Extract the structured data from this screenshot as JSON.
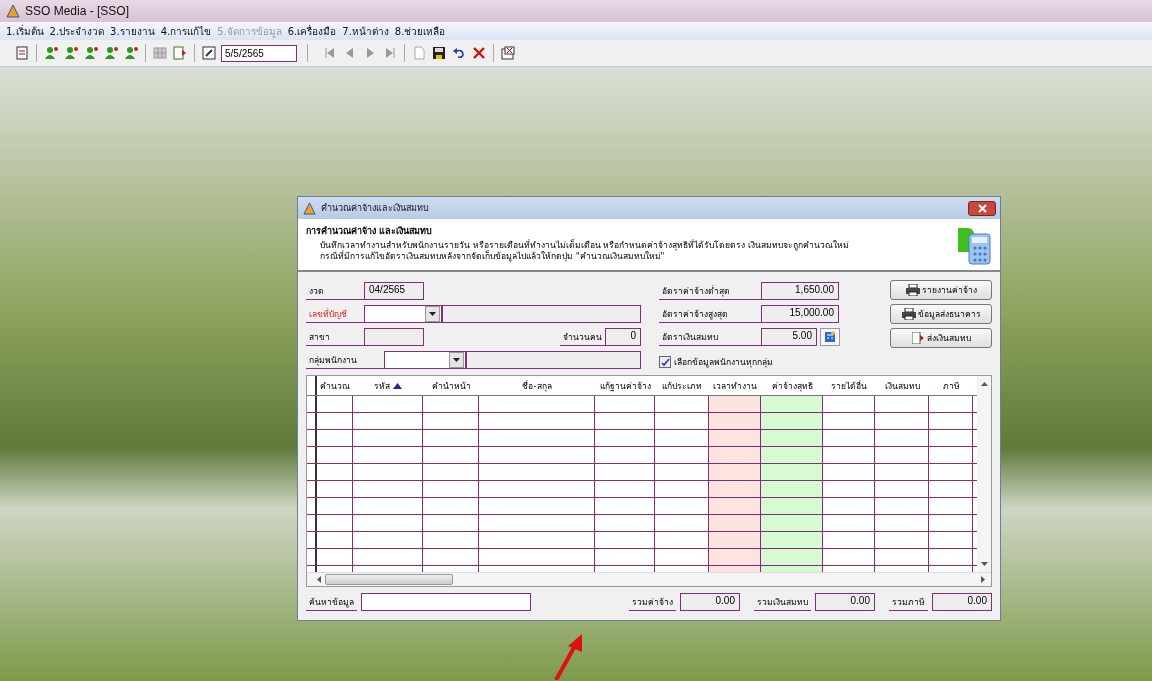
{
  "window": {
    "title": "SSO Media - [SSO]"
  },
  "menu": [
    {
      "label": "1.เริ่มต้น",
      "disabled": false
    },
    {
      "label": "2.ประจำงวด",
      "disabled": false
    },
    {
      "label": "3.รายงาน",
      "disabled": false
    },
    {
      "label": "4.การแก้ไข",
      "disabled": false
    },
    {
      "label": "5.จัดการข้อมูล",
      "disabled": true
    },
    {
      "label": "6.เครื่องมือ",
      "disabled": false
    },
    {
      "label": "7.หน้าต่าง",
      "disabled": false
    },
    {
      "label": "8.ช่วยเหลือ",
      "disabled": false
    }
  ],
  "toolbar": {
    "date": "5/5/2565"
  },
  "dialog": {
    "title": "คำนวณค่าจ้างและเงินสมทบ",
    "heading": "การคำนวณค่าจ้าง และเงินสมทบ",
    "description": [
      "บันทึกเวลาทำงานสำหรับพนักงานรายวัน หรือรายเดือนที่ทำงานไม่เต็มเดือน หรือกำหนดค่าจ้างสุทธิที่ได้รับโดยตรง เงินสมทบจะถูกคำนวณใหม่",
      "กรณีที่มีการแก้ไขอัตราเงินสมทบหลังจากจัดเก็บข้อมูลไปแล้วให้กดปุ่ม \"คำนวณเงินสมทบใหม่\""
    ],
    "period": {
      "label": "งวด",
      "value": "04/2565"
    },
    "account": {
      "label": "เลขที่บัญชี",
      "required": true
    },
    "branch": {
      "label": "สาขา"
    },
    "headcount": {
      "label": "จำนวนคน",
      "value": "0"
    },
    "group": {
      "label": "กลุ่มพนักงาน"
    },
    "rates": [
      {
        "label": "อัตราค่าจ้างต่ำสุด",
        "value": "1,650.00"
      },
      {
        "label": "อัตราค่าจ้างสูงสุด",
        "value": "15,000.00"
      },
      {
        "label": "อัตราเงินสมทบ",
        "value": "5.00"
      }
    ],
    "all_groups": {
      "label": "เลือกข้อมูลพนักงานทุกกลุ่ม",
      "checked": true
    },
    "buttons": [
      "รายงานค่าจ้าง",
      "ข้อมูลส่งธนาคาร",
      "ส่งเงินสมทบ"
    ],
    "table": {
      "columns": [
        {
          "label": "คำนวณ",
          "sorted": false,
          "color": "#ffffff"
        },
        {
          "label": "รหัส",
          "sorted": true,
          "color": "#ffffff"
        },
        {
          "label": "คำนำหน้า",
          "sorted": false,
          "color": "#ffffff"
        },
        {
          "label": "ชื่อ-สกุล",
          "sorted": false,
          "color": "#ffffff"
        },
        {
          "label": "แก้ฐานค่าจ้าง",
          "sorted": false,
          "color": "#ffffff"
        },
        {
          "label": "แก้ประเภท",
          "sorted": false,
          "color": "#ffffff"
        },
        {
          "label": "เวลาทำงาน",
          "sorted": false,
          "color": "#fde4de"
        },
        {
          "label": "ค่าจ้างสุทธิ",
          "sorted": false,
          "color": "#d6fbd3"
        },
        {
          "label": "รายได้อื่น",
          "sorted": false,
          "color": "#ffffff"
        },
        {
          "label": "เงินสมทบ",
          "sorted": false,
          "color": "#ffffff"
        },
        {
          "label": "ภาษี",
          "sorted": false,
          "color": "#ffffff"
        }
      ]
    },
    "search": {
      "label": "ค้นหาข้อมูล"
    },
    "totals": [
      {
        "label": "รวมค่าจ้าง",
        "value": "0.00"
      },
      {
        "label": "รวมเงินสมทบ",
        "value": "0.00"
      },
      {
        "label": "รวมภาษี",
        "value": "0.00"
      }
    ]
  }
}
